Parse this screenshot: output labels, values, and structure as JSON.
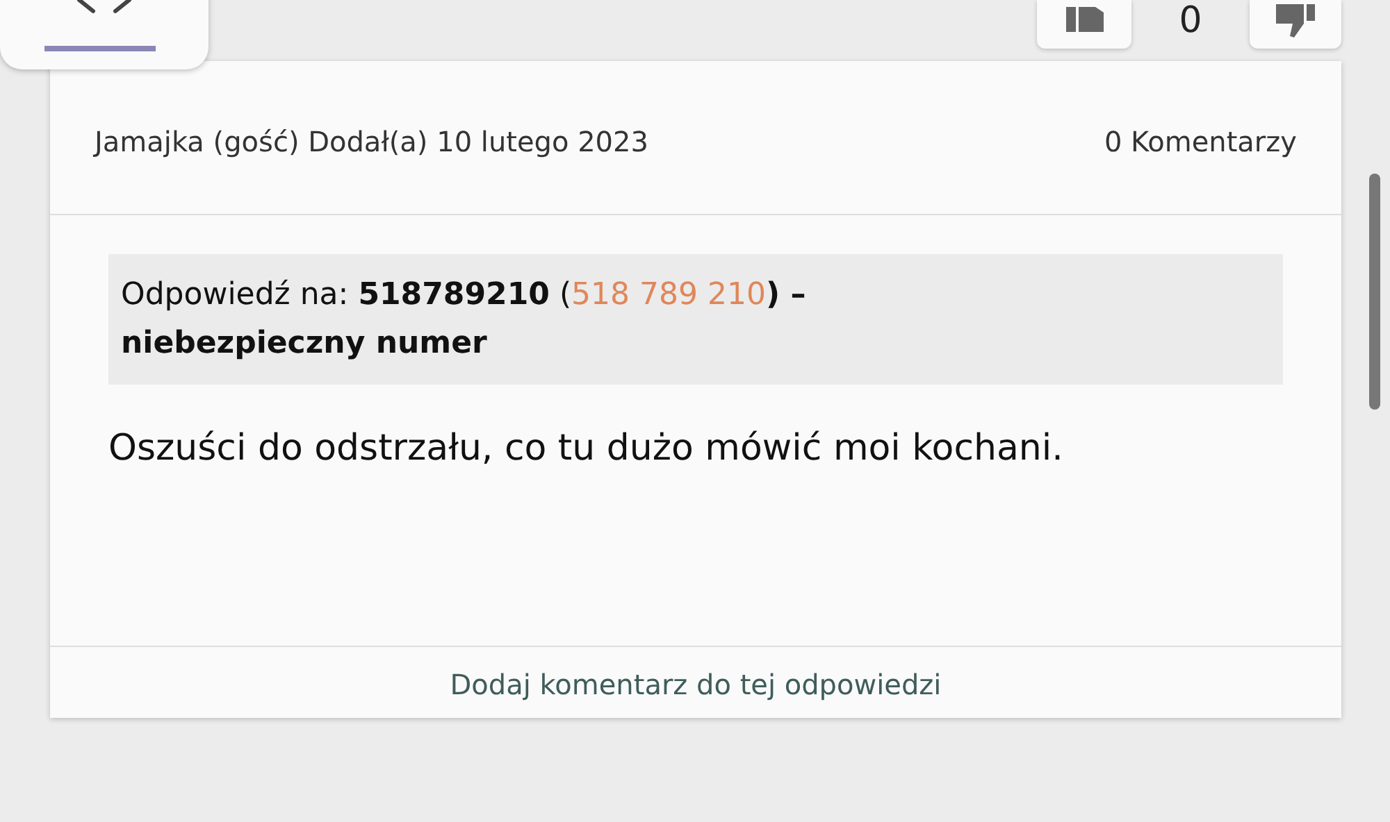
{
  "top_bar": {
    "vote_count": "0"
  },
  "answer": {
    "author": "Jamajka (gość)",
    "added": "Dodał(a) 10 lutego 2023",
    "comments": "0 Komentarzy",
    "reply_to": {
      "prefix": "Odpowiedź na: **518789210** (",
      "link": "518 789 210",
      "suffix": "**) – niebezpieczny numer**"
    },
    "body": "Oszuści do odstrzału, co tu dużo mówić moi kochani.",
    "add_comment": "Dodaj komentarz do tej odpowiedzi"
  }
}
